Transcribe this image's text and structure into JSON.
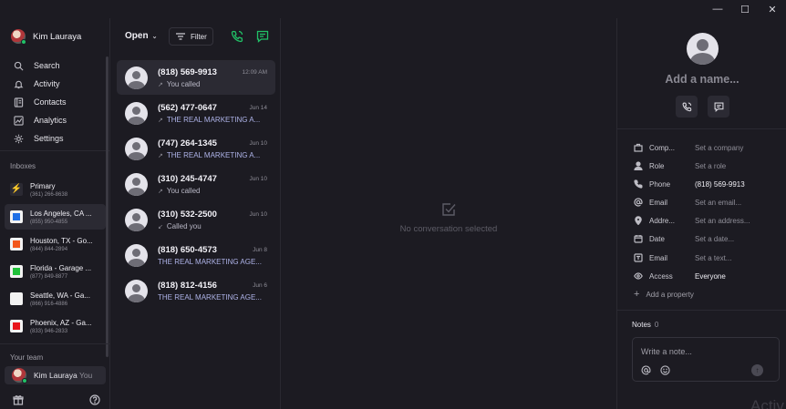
{
  "window": {
    "minimize": "—",
    "maximize": "☐",
    "close": "✕"
  },
  "sidebar": {
    "user_name": "Kim Lauraya",
    "nav": [
      {
        "label": "Search",
        "icon": "search-icon"
      },
      {
        "label": "Activity",
        "icon": "bell-icon"
      },
      {
        "label": "Contacts",
        "icon": "contacts-icon"
      },
      {
        "label": "Analytics",
        "icon": "analytics-icon"
      },
      {
        "label": "Settings",
        "icon": "gear-icon"
      }
    ],
    "inboxes_label": "Inboxes",
    "inboxes": [
      {
        "name": "Primary",
        "number": "(361) 266-8638",
        "color": "#f5a623",
        "icon": "lightning-icon"
      },
      {
        "name": "Los Angeles, CA ...",
        "number": "(855) 950-4855",
        "color": "#1f6fe5"
      },
      {
        "name": "Houston, TX - Go...",
        "number": "(844) 844-2894",
        "color": "#f2571c"
      },
      {
        "name": "Florida - Garage ...",
        "number": "(877) 849-8877",
        "color": "#21c13a"
      },
      {
        "name": "Seattle, WA - Ga...",
        "number": "(866) 916-4886",
        "color": "#f2f2f2"
      },
      {
        "name": "Phoenix, AZ - Ga...",
        "number": "(833) 946-2833",
        "color": "#e8151b"
      }
    ],
    "team_label": "Your team",
    "team_member": "Kim Lauraya",
    "team_you": "You"
  },
  "list": {
    "status": "Open",
    "filter_label": "Filter",
    "conversations": [
      {
        "phone": "(818) 569-9913",
        "time": "12:09 AM",
        "sub": "You called",
        "arrow": "↗",
        "style": "grey"
      },
      {
        "phone": "(562) 477-0647",
        "time": "Jun 14",
        "sub": "THE REAL MARKETING A...",
        "arrow": "↗",
        "style": "blue"
      },
      {
        "phone": "(747) 264-1345",
        "time": "Jun 10",
        "sub": "THE REAL MARKETING A...",
        "arrow": "↗",
        "style": "blue"
      },
      {
        "phone": "(310) 245-4747",
        "time": "Jun 10",
        "sub": "You called",
        "arrow": "↗",
        "style": "grey"
      },
      {
        "phone": "(310) 532-2500",
        "time": "Jun 10",
        "sub": "Called you",
        "arrow": "↙",
        "style": "grey"
      },
      {
        "phone": "(818) 650-4573",
        "time": "Jun 8",
        "sub": "THE REAL MARKETING AGE...",
        "arrow": "",
        "style": "blue"
      },
      {
        "phone": "(818) 812-4156",
        "time": "Jun 6",
        "sub": "THE REAL MARKETING AGE...",
        "arrow": "",
        "style": "blue"
      }
    ]
  },
  "center": {
    "empty_text": "No conversation selected"
  },
  "details": {
    "add_name": "Add a name...",
    "properties": [
      {
        "name": "Comp...",
        "value": "Set a company",
        "set": false,
        "icon": "company-icon"
      },
      {
        "name": "Role",
        "value": "Set a role",
        "set": false,
        "icon": "person-icon"
      },
      {
        "name": "Phone",
        "value": "(818) 569-9913",
        "set": true,
        "icon": "phone-icon"
      },
      {
        "name": "Email",
        "value": "Set an email...",
        "set": false,
        "icon": "at-icon"
      },
      {
        "name": "Addre...",
        "value": "Set an address...",
        "set": false,
        "icon": "location-pin-icon"
      },
      {
        "name": "Date",
        "value": "Set a date...",
        "set": false,
        "icon": "calendar-icon"
      },
      {
        "name": "Email",
        "value": "Set a text...",
        "set": false,
        "icon": "text-icon"
      },
      {
        "name": "Access",
        "value": "Everyone",
        "set": true,
        "icon": "eye-icon"
      }
    ],
    "add_property": "Add a property",
    "notes_label": "Notes",
    "notes_count": "0",
    "note_placeholder": "Write a note..."
  },
  "watermark": "Activ"
}
